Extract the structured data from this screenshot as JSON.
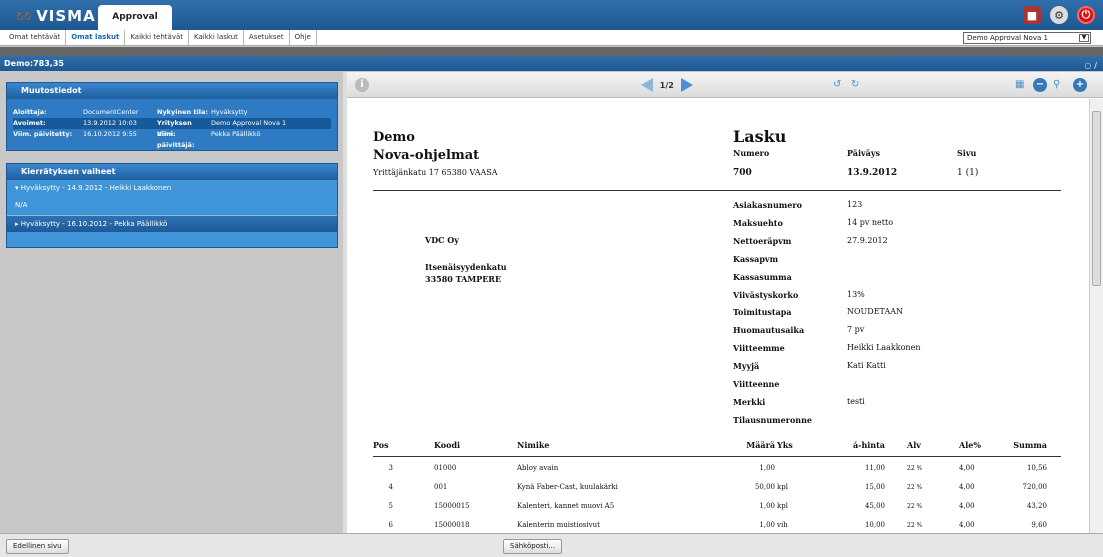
{
  "header": {
    "logo": "VISMA",
    "app_tab": "Approval"
  },
  "nav": {
    "items": [
      "Omat tehtävät",
      "Omat laskut",
      "Kaikki tehtävät",
      "Kaikki laskut",
      "Asetukset",
      "Ohje"
    ],
    "active": "Omat laskut",
    "company_select": "Demo Approval Nova 1"
  },
  "demo_bar": {
    "title": "Demo:783,35"
  },
  "muutostiedot": {
    "title": "Muutostiedot",
    "rows": [
      {
        "l1": "Aloittaja:",
        "v1": "DocumentCenter",
        "l2": "Nykyinen tila:",
        "v2": "Hyväksytty"
      },
      {
        "l1": "Avoimet:",
        "v1": "13.9.2012 10:03",
        "l2": "Yrityksen nimi:",
        "v2": "Demo Approval Nova 1"
      },
      {
        "l1": "Viim. päivitetty:",
        "v1": "16.10.2012 9:55",
        "l2": "Viim. päivittäjä:",
        "v2": "Pekka Päällikkö"
      }
    ]
  },
  "kierratys": {
    "title": "Kierrätyksen vaiheet",
    "step1": "Hyväksytty - 14.9.2012 - Heikki Laakkonen",
    "step1_note": "N/A",
    "step2": "Hyväksytty - 16.10.2012 - Pekka Päällikkö"
  },
  "viewer": {
    "page": "1/2"
  },
  "invoice": {
    "seller_name": "Demo",
    "seller_company": "Nova-ohjelmat",
    "seller_address": "Yrittäjänkatu 17 65380  VAASA",
    "doc_title": "Lasku",
    "h_numero": "Numero",
    "h_paivays": "Päiväys",
    "h_sivu": "Sivu",
    "numero": "700",
    "paivays": "13.9.2012",
    "sivu": "1 (1)",
    "buyer_name": "VDC Oy",
    "buyer_street": "Itsenäisyydenkatu",
    "buyer_city": "33580 TAMPERE",
    "details": [
      {
        "label": "Asiakasnumero",
        "value": "123"
      },
      {
        "label": "Maksuehto",
        "value": "14 pv netto"
      },
      {
        "label": "Nettoeräpvm",
        "value": "27.9.2012"
      },
      {
        "label": "Kassapvm",
        "value": ""
      },
      {
        "label": "Kassasumma",
        "value": ""
      },
      {
        "label": "Viivästyskorko",
        "value": "13%"
      },
      {
        "label": "Toimitustapa",
        "value": "NOUDETAAN"
      },
      {
        "label": "Huomautusaika",
        "value": "7 pv"
      },
      {
        "label": "Viitteemme",
        "value": "Heikki Laakkonen"
      },
      {
        "label": "Myyjä",
        "value": "Kati Katti"
      },
      {
        "label": "Viitteenne",
        "value": ""
      },
      {
        "label": "Merkki",
        "value": "testi"
      },
      {
        "label": "Tilausnumeronne",
        "value": ""
      }
    ],
    "columns": [
      "Pos",
      "Koodi",
      "Nimike",
      "Määrä",
      "Yks",
      "á-hinta",
      "Alv",
      "Ale%",
      "Summa"
    ],
    "rows": [
      {
        "pos": "3",
        "koodi": "01000",
        "nimike": "Abloy avain",
        "maara": "1,00",
        "yks": "",
        "hinta": "11,00",
        "alv": "22 %",
        "ale": "4,00",
        "summa": "10,56"
      },
      {
        "pos": "4",
        "koodi": "001",
        "nimike": "Kynä Faber-Cast, kuulakärki",
        "maara": "50,00",
        "yks": "kpl",
        "hinta": "15,00",
        "alv": "22 %",
        "ale": "4,00",
        "summa": "720,00"
      },
      {
        "pos": "5",
        "koodi": "15000015",
        "nimike": "Kalenteri, kannet muovi A5",
        "maara": "1,00",
        "yks": "kpl",
        "hinta": "45,00",
        "alv": "22 %",
        "ale": "4,00",
        "summa": "43,20"
      },
      {
        "pos": "6",
        "koodi": "15000018",
        "nimike": "Kalenterin muistiosivut",
        "maara": "1,00",
        "yks": "vih",
        "hinta": "10,00",
        "alv": "22 %",
        "ale": "4,00",
        "summa": "9,60"
      }
    ]
  },
  "bottom": {
    "prev_button": "Edellinen sivu",
    "email_button": "Sähköposti..."
  }
}
